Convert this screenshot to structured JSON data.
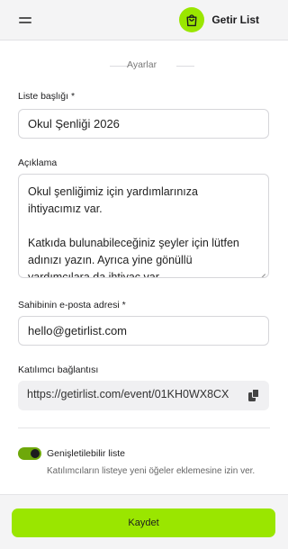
{
  "header": {
    "menu_icon": "hamburger-menu-icon",
    "brand_icon": "shopping-bag-icon",
    "brand_name": "Getir List",
    "brand_color": "#9ae600"
  },
  "form": {
    "section_title": "Ayarlar",
    "list_title": {
      "label": "Liste başlığı *",
      "value": "Okul Şenliği 2026"
    },
    "description": {
      "label": "Açıklama",
      "line1": "Okul şenliğimiz için yardımlarınıza",
      "line2": "ihtiyacımız var.",
      "line3": "Katkıda bulunabileceğiniz şeyler için lütfen",
      "line4": "adınızı yazın. Ayrıca yine gönüllü",
      "line5": "yardımcılara da ihtiyaç var."
    },
    "owner_email": {
      "label": "Sahibinin e-posta adresi *",
      "value": "hello@getirlist.com"
    },
    "participant_link": {
      "label": "Katılımcı bağlantısı",
      "value": "https://getirlist.com/event/01KH0WX8CX",
      "copy_icon": "copy-icon"
    },
    "extensible": {
      "title": "Genişletilebilir liste",
      "description": "Katılımcıların listeye yeni öğeler eklemesine izin ver.",
      "enabled": true
    }
  },
  "footer": {
    "save_label": "Kaydet",
    "button_color": "#9ae600"
  }
}
